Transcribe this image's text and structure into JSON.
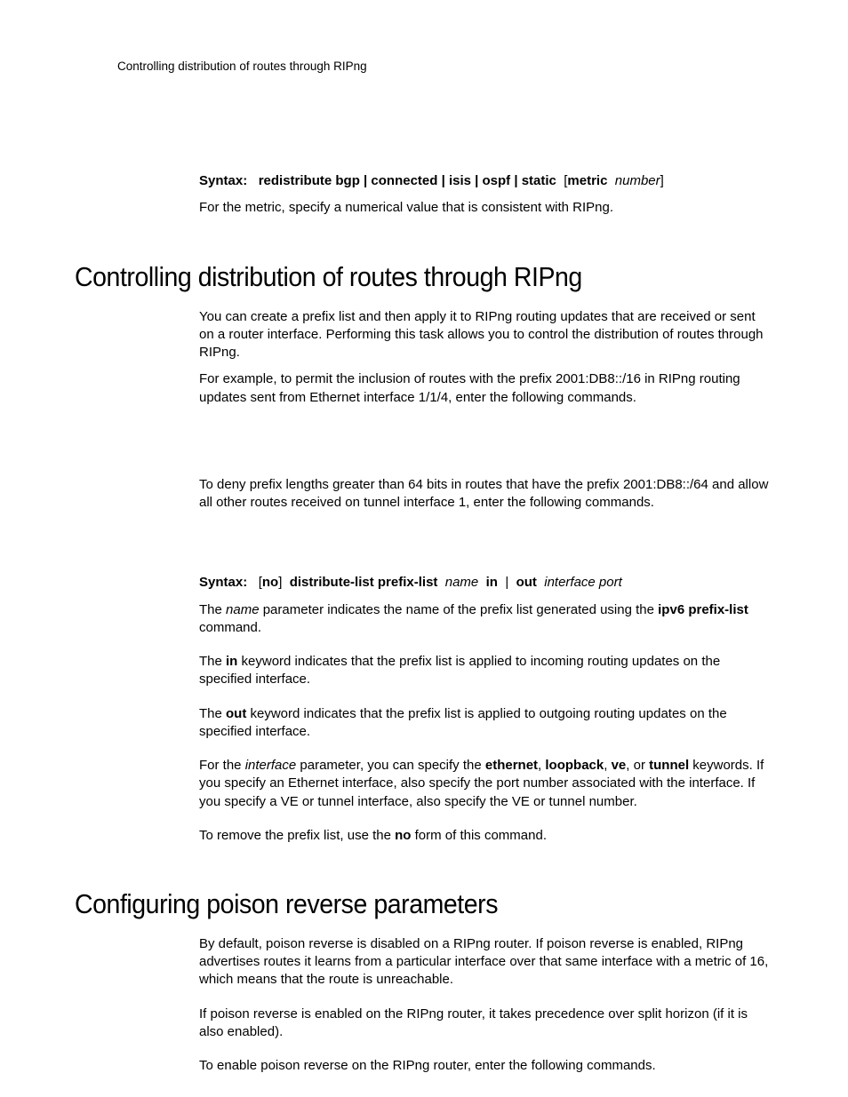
{
  "header": {
    "running": "Controlling distribution of routes through RIPng"
  },
  "syntax1": {
    "label": "Syntax:",
    "body": "redistribute bgp | connected | isis | ospf | static",
    "brO": "[",
    "metric": "metric",
    "number": "number",
    "brC": "]"
  },
  "p_metric": "For the metric, specify a numerical value that is consistent with RIPng.",
  "h1a": "Controlling distribution of routes through RIPng",
  "p1": "You can create a prefix list and then apply it to RIPng routing updates that are received or sent on a router interface. Performing this task allows you to control the distribution of routes through RIPng.",
  "p2": "For example, to permit the inclusion of routes with the prefix 2001:DB8::/16 in RIPng routing updates sent from Ethernet interface 1/1/4, enter the following commands.",
  "p3": "To deny prefix lengths greater than 64 bits in routes that have the prefix 2001:DB8::/64 and allow all other routes received on tunnel interface 1, enter the following commands.",
  "syntax2": {
    "label": "Syntax:",
    "no_o": "[",
    "no": "no",
    "no_c": "]",
    "dl": "distribute-list prefix-list",
    "name": "name",
    "inw": "in",
    "pipe": "|",
    "outw": "out",
    "ifport": "interface port"
  },
  "p4a": "The ",
  "p4b": "name",
  "p4c": " parameter indicates the name of the prefix list generated using the ",
  "p4d": "ipv6 prefix-list",
  "p4e": " command.",
  "p5a": "The ",
  "p5b": "in",
  "p5c": " keyword indicates that the prefix list is applied to incoming routing updates on the specified interface.",
  "p6a": "The ",
  "p6b": "out",
  "p6c": " keyword indicates that the prefix list is applied to outgoing routing updates on the specified interface.",
  "p7a": "For the ",
  "p7b": "interface",
  "p7c": " parameter, you can specify the ",
  "p7d": "ethernet",
  "p7e": ", ",
  "p7f": "loopback",
  "p7g": ", ",
  "p7h": "ve",
  "p7i": ", or ",
  "p7j": "tunnel",
  "p7k": " keywords. If you specify an Ethernet interface, also specify the port number associated with the interface. If you specify a VE or tunnel interface, also specify the VE or tunnel number.",
  "p8a": "To remove the prefix list, use the ",
  "p8b": "no",
  "p8c": " form of this command.",
  "h1b": "Configuring poison reverse parameters",
  "p9": "By default, poison reverse is disabled on a RIPng router. If poison reverse is enabled, RIPng advertises routes it learns from a particular interface over that same interface with a metric of 16, which means that the route is unreachable.",
  "p10": "If poison reverse is enabled on the RIPng router, it takes precedence over split horizon (if it is also enabled).",
  "p11": "To enable poison reverse on the RIPng router, enter the following commands."
}
